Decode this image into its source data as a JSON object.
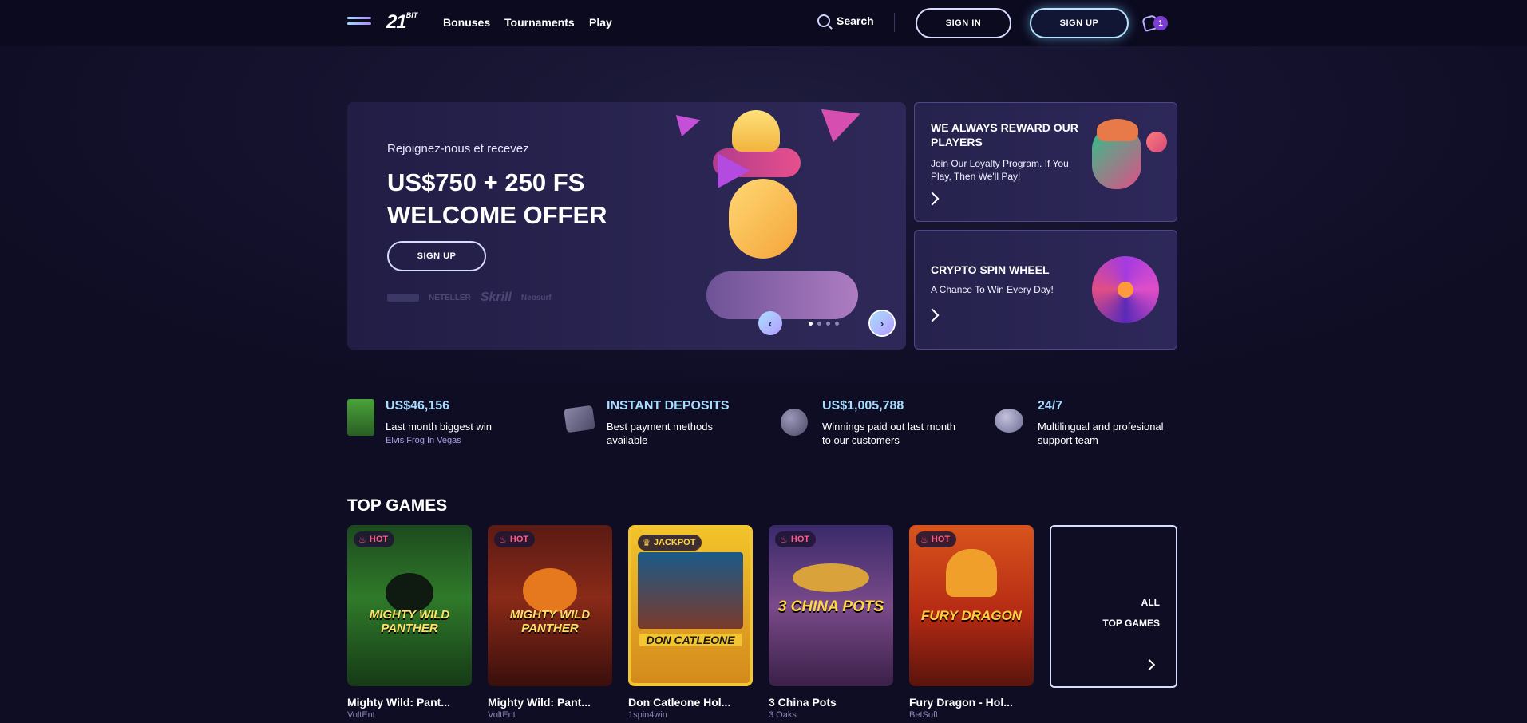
{
  "header": {
    "logo_main": "21",
    "logo_suffix": "BIT",
    "nav": [
      "Bonuses",
      "Tournaments",
      "Play"
    ],
    "search_label": "Search",
    "sign_in": "SIGN IN",
    "sign_up": "SIGN UP",
    "notification_count": "1"
  },
  "hero": {
    "subtitle": "Rejoignez-nous et recevez",
    "title_line1": "US$750 + 250 FS",
    "title_line2": "WELCOME OFFER",
    "cta": "SIGN UP",
    "payment_logos": [
      "NETELLER",
      "Skrill",
      "Neosurf"
    ],
    "slides_total": 4,
    "slide_active": 1
  },
  "promos": [
    {
      "title": "WE ALWAYS REWARD OUR PLAYERS",
      "description": "Join Our Loyalty Program. If You Play, Then We'll Pay!"
    },
    {
      "title": "CRYPTO SPIN WHEEL",
      "description": "A Chance To Win Every Day!"
    }
  ],
  "stats": [
    {
      "value": "US$46,156",
      "desc": "Last month biggest win",
      "sub": "Elvis Frog In Vegas",
      "icon": "game-thumbnail-icon"
    },
    {
      "value": "INSTANT DEPOSITS",
      "desc": "Best payment methods available",
      "icon": "wallet-icon"
    },
    {
      "value": "US$1,005,788",
      "desc": "Winnings paid out last month to our customers",
      "icon": "coin-icon"
    },
    {
      "value": "24/7",
      "desc": "Multilingual and profesional support team",
      "icon": "chat-bubble-icon"
    }
  ],
  "top_games": {
    "title": "TOP GAMES",
    "all_label_line1": "ALL",
    "all_label_line2": "TOP GAMES",
    "games": [
      {
        "tag": "HOT",
        "name": "Mighty Wild: Pant...",
        "provider": "VoltEnt",
        "art": "MIGHTY WILD PANTHER"
      },
      {
        "tag": "HOT",
        "name": "Mighty Wild: Pant...",
        "provider": "VoltEnt",
        "art": "MIGHTY WILD PANTHER"
      },
      {
        "tag": "JACKPOT",
        "name": "Don Catleone Hol...",
        "provider": "1spin4win",
        "art": "DON CATLEONE"
      },
      {
        "tag": "HOT",
        "name": "3 China Pots",
        "provider": "3 Oaks",
        "art": "3 CHINA POTS"
      },
      {
        "tag": "HOT",
        "name": "Fury Dragon - Hol...",
        "provider": "BetSoft",
        "art": "FURY DRAGON"
      }
    ]
  },
  "colors": {
    "background": "#0f0d24",
    "accent_cyan": "#a7dcff",
    "hot_pink": "#ff5b8a",
    "jackpot_gold": "#ffd54a"
  }
}
